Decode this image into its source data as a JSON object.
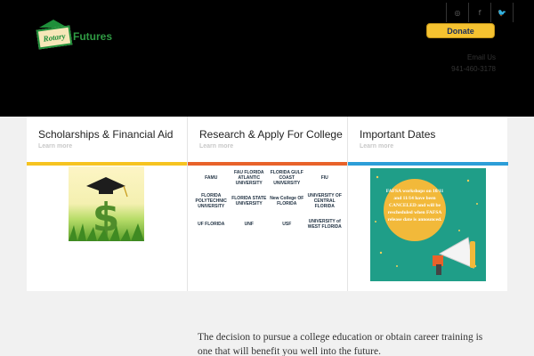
{
  "header": {
    "logo": {
      "part1": "Rotary",
      "part2": "Futures"
    },
    "social_icons": [
      "instagram-icon",
      "facebook-icon",
      "twitter-icon"
    ],
    "social_glyphs": [
      "◎",
      "f",
      "🐦"
    ],
    "donate_label": "Donate",
    "contact": {
      "email": "Email Us",
      "phone": "941-460-3178"
    }
  },
  "cards": [
    {
      "title": "Scholarships & Financial Aid",
      "link": "Learn more",
      "accent": "#f6c320"
    },
    {
      "title": "Research & Apply For College",
      "link": "Learn more",
      "accent": "#e8622a"
    },
    {
      "title": "Important Dates",
      "link": "Learn more",
      "accent": "#2c9ed8"
    }
  ],
  "college_logos": [
    "FAMU",
    "FAU FLORIDA ATLANTIC UNIVERSITY",
    "FLORIDA GULF COAST UNIVERSITY",
    "FIU",
    "FLORIDA POLYTECHNIC UNIVERSITY",
    "FLORIDA STATE UNIVERSITY",
    "New College OF FLORIDA",
    "UNIVERSITY OF CENTRAL FLORIDA",
    "UF FLORIDA",
    "UNF",
    "USF",
    "UNIVERSITY of WEST FLORIDA"
  ],
  "dates_image_text": "FAFSA workshops on 10/11 and 11/14 have been CANCELED and will be rescheduled when FAFSA release date is announced.",
  "intro_text": "The decision to pursue a college education or obtain career training is one that will benefit you well into the future."
}
